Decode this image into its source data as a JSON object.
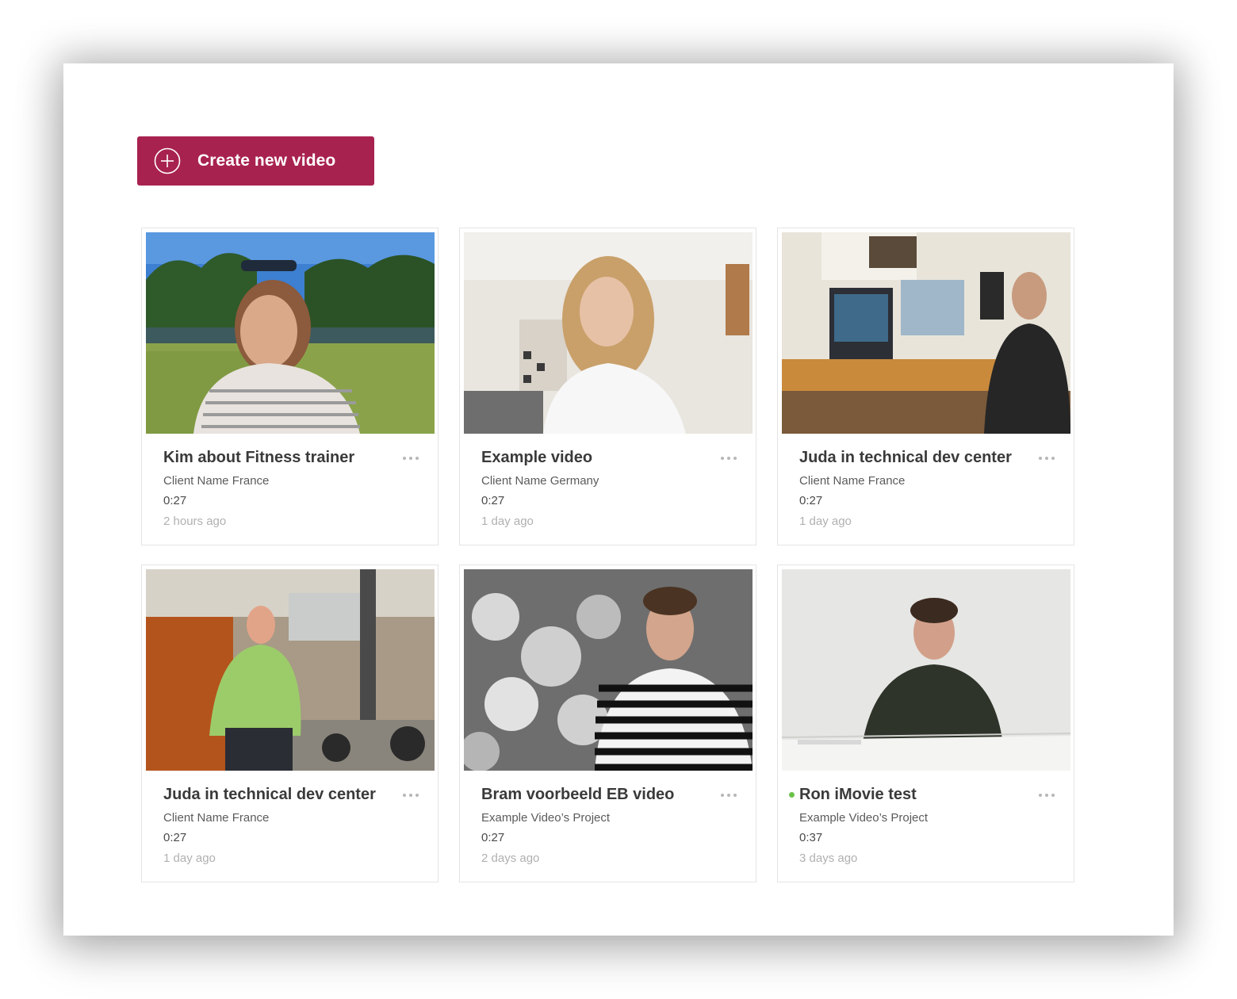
{
  "toolbar": {
    "create_label": "Create new video",
    "create_icon": "plus-circle-icon",
    "accent": "#a8224f"
  },
  "videos": [
    {
      "title": "Kim about Fitness trainer",
      "client": "Client Name France",
      "duration": "0:27",
      "ago": "2 hours ago",
      "live": false
    },
    {
      "title": "Example video",
      "client": "Client Name Germany",
      "duration": "0:27",
      "ago": "1 day ago",
      "live": false
    },
    {
      "title": "Juda in technical dev center",
      "client": "Client Name France",
      "duration": "0:27",
      "ago": "1 day ago",
      "live": false
    },
    {
      "title": "Juda in technical dev center",
      "client": "Client Name France",
      "duration": "0:27",
      "ago": "1 day ago",
      "live": false
    },
    {
      "title": "Bram voorbeeld EB video",
      "client": "Example Video’s Project",
      "duration": "0:27",
      "ago": "2 days ago",
      "live": false
    },
    {
      "title": "Ron iMovie test",
      "client": "Example Video’s Project",
      "duration": "0:37",
      "ago": "3 days ago",
      "live": true
    }
  ],
  "status_color": "#6cc24a",
  "more_icon": "more-dots-icon"
}
